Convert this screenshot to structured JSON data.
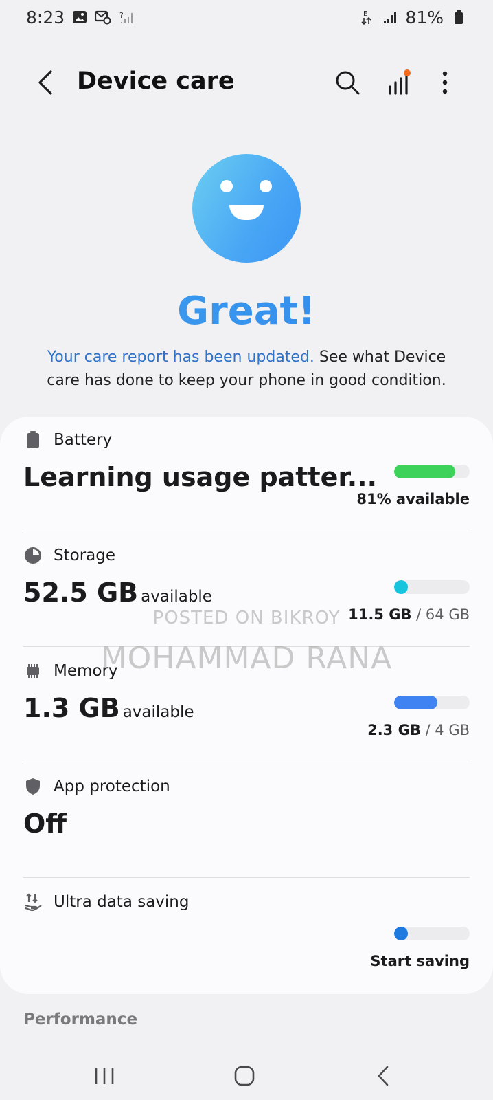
{
  "status_bar": {
    "time": "8:23",
    "battery": "81%"
  },
  "app_bar": {
    "title": "Device care"
  },
  "hero": {
    "headline": "Great!",
    "report_link": "Your care report has been updated.",
    "report_rest": " See what Device care has done to keep your phone in good condition."
  },
  "items": {
    "battery": {
      "label": "Battery",
      "value": "Learning usage patter...",
      "level_fraction": 0.81,
      "right_bold": "81% available",
      "bar_color": "#3dd35a"
    },
    "storage": {
      "label": "Storage",
      "value": "52.5 GB",
      "suffix": "available",
      "used": "11.5 GB",
      "total": "/ 64 GB",
      "used_fraction": 0.18,
      "bar_color": "#16c4dd"
    },
    "memory": {
      "label": "Memory",
      "value": "1.3 GB",
      "suffix": "available",
      "used": "2.3 GB",
      "total": "/ 4 GB",
      "used_fraction": 0.575,
      "bar_color": "#3f82f2"
    },
    "app_protection": {
      "label": "App protection",
      "value": "Off"
    },
    "ultra_data_saving": {
      "label": "Ultra data saving",
      "action": "Start saving",
      "bar_color": "#1f7ae0"
    }
  },
  "section": {
    "performance": "Performance"
  },
  "watermark": {
    "line1": "POSTED ON BIKROY",
    "line2": "MOHAMMAD RANA"
  }
}
